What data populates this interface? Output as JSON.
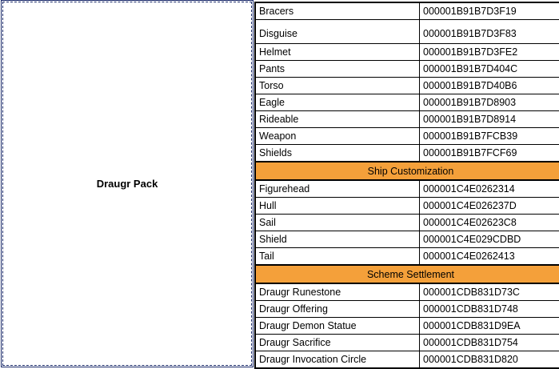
{
  "pack_name": "Draugr Pack",
  "rows_top": [
    {
      "name": "Bracers",
      "id": "000001B91B7D3F19"
    },
    {
      "name": "Disguise",
      "id": "000001B91B7D3F83"
    },
    {
      "name": "Helmet",
      "id": "000001B91B7D3FE2"
    },
    {
      "name": "Pants",
      "id": "000001B91B7D404C"
    },
    {
      "name": "Torso",
      "id": "000001B91B7D40B6"
    },
    {
      "name": "Eagle",
      "id": "000001B91B7D8903"
    },
    {
      "name": "Rideable",
      "id": "000001B91B7D8914"
    },
    {
      "name": "Weapon",
      "id": "000001B91B7FCB39"
    },
    {
      "name": "Shields",
      "id": "000001B91B7FCF69"
    }
  ],
  "section_ship": "Ship Customization",
  "rows_ship": [
    {
      "name": "Figurehead",
      "id": "000001C4E0262314"
    },
    {
      "name": "Hull",
      "id": "000001C4E026237D"
    },
    {
      "name": "Sail",
      "id": "000001C4E02623C8"
    },
    {
      "name": "Shield",
      "id": "000001C4E029CDBD"
    },
    {
      "name": "Tail",
      "id": "000001C4E0262413"
    }
  ],
  "section_settlement": "Scheme Settlement",
  "rows_settlement": [
    {
      "name": "Draugr Runestone",
      "id": "000001CDB831D73C"
    },
    {
      "name": "Draugr Offering",
      "id": "000001CDB831D748"
    },
    {
      "name": "Draugr Demon Statue",
      "id": "000001CDB831D9EA"
    },
    {
      "name": "Draugr Sacrifice",
      "id": "000001CDB831D754"
    },
    {
      "name": "Draugr Invocation Circle",
      "id": "000001CDB831D820"
    }
  ],
  "colors": {
    "section_header_bg": "#f4a03a",
    "border": "#000000",
    "left_cell_border": "#1a2a6a"
  }
}
